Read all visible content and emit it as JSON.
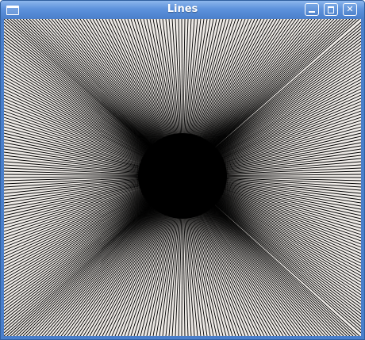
{
  "window": {
    "title": "Lines",
    "icon": "window-app-icon",
    "buttons": {
      "minimize_icon": "minimize-icon",
      "maximize_icon": "maximize-icon",
      "close_label": "✕"
    }
  },
  "canvas": {
    "background": "#efebe7",
    "line_color": "#000000",
    "description_free": true
  },
  "colors": {
    "titlebar": "#4a7fcb",
    "frame": "#2f5f9f"
  }
}
